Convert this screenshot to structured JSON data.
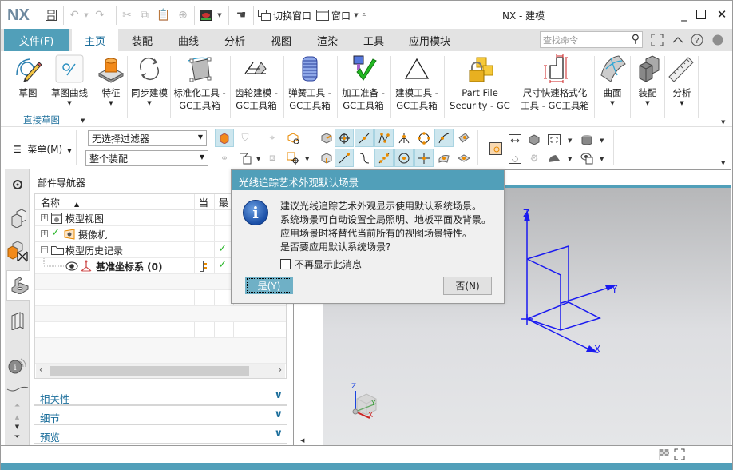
{
  "app": {
    "logo": "NX",
    "title": "NX - 建模"
  },
  "quick_access": {
    "switch_window": "切换窗口",
    "window": "窗口"
  },
  "window_controls": {
    "minimize": "_",
    "maximize": "☐",
    "close": "✕"
  },
  "tabs": {
    "file": "文件(F)",
    "items": [
      "主页",
      "装配",
      "曲线",
      "分析",
      "视图",
      "渲染",
      "工具",
      "应用模块"
    ],
    "active_index": 0
  },
  "search": {
    "placeholder": "查找命令"
  },
  "ribbon": {
    "buttons": [
      {
        "label1": "草图",
        "label2": "",
        "dropdown": false
      },
      {
        "label1": "草图曲线",
        "label2": "",
        "dropdown": true
      },
      {
        "label1": "特征",
        "label2": "",
        "dropdown": true
      },
      {
        "label1": "同步建模",
        "label2": "",
        "dropdown": true
      },
      {
        "label1": "标准化工具 -",
        "label2": "GC工具箱",
        "dropdown": true
      },
      {
        "label1": "齿轮建模 -",
        "label2": "GC工具箱",
        "dropdown": true
      },
      {
        "label1": "弹簧工具 -",
        "label2": "GC工具箱",
        "dropdown": true
      },
      {
        "label1": "加工准备 -",
        "label2": "GC工具箱",
        "dropdown": true
      },
      {
        "label1": "建模工具 -",
        "label2": "GC工具箱",
        "dropdown": true
      },
      {
        "label1": "Part File",
        "label2": "Security - GC",
        "dropdown": true
      },
      {
        "label1": "尺寸快速格式化",
        "label2": "工具 - GC工具箱",
        "dropdown": true
      },
      {
        "label1": "曲面",
        "label2": "",
        "dropdown": true
      },
      {
        "label1": "装配",
        "label2": "",
        "dropdown": true
      },
      {
        "label1": "分析",
        "label2": "",
        "dropdown": true
      }
    ],
    "group_label": "直接草图"
  },
  "toolbar2": {
    "menu_label": "菜单(M)",
    "filter_value": "无选择过滤器",
    "scope_value": "整个装配"
  },
  "navigator": {
    "title": "部件导航器",
    "columns": [
      "名称",
      "当",
      "最"
    ],
    "sort": "ascending",
    "rows": [
      {
        "name": "模型视图",
        "expander": "+",
        "current": "",
        "latest": "",
        "bold": false
      },
      {
        "name": "摄像机",
        "expander": "+",
        "current": "",
        "latest": "",
        "bold": false
      },
      {
        "name": "模型历史记录",
        "expander": "−",
        "current": "",
        "latest": "✓",
        "bold": false
      },
      {
        "name": "基准坐标系 (0)",
        "expander": "",
        "current": "dependency",
        "latest": "✓",
        "bold": true
      }
    ],
    "panels": [
      "相关性",
      "细节",
      "预览"
    ]
  },
  "dialog": {
    "title": "光线追踪艺术外观默认场景",
    "message": [
      "建议光线追踪艺术外观显示使用默认系统场景。",
      "系统场景可自动设置全局照明、地板平面及背景。",
      "应用场景时将替代当前所有的视图场景特性。",
      "是否要应用默认系统场景?"
    ],
    "checkbox_label": "不再显示此消息",
    "checkbox_checked": false,
    "yes_label": "是(Y)",
    "no_label": "否(N)"
  },
  "viewport": {
    "axis_labels": {
      "x": "X",
      "y": "Y",
      "z": "Z"
    },
    "triad_labels": {
      "x": "X",
      "y": "Y",
      "z": "Z"
    }
  },
  "colors": {
    "accent": "#519fb9",
    "link_blue": "#1b6e9b",
    "datum_blue": "#1a1af0",
    "check_green": "#2fb82f"
  }
}
